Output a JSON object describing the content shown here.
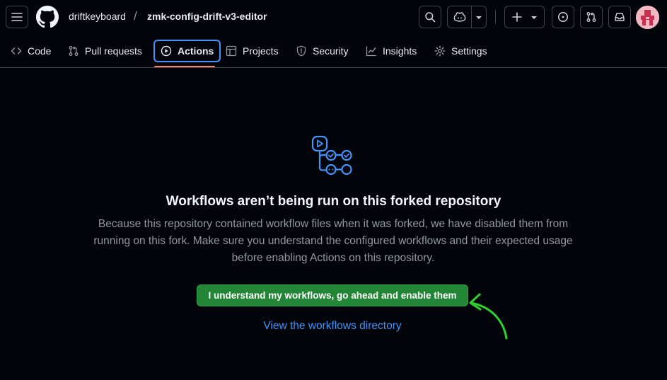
{
  "header": {
    "owner": "driftkeyboard",
    "separator": "/",
    "repo": "zmk-config-drift-v3-editor",
    "icons": [
      "menu-icon",
      "github-logo",
      "search-icon",
      "copilot-icon",
      "chevron-down-icon",
      "plus-icon",
      "issues-icon",
      "pull-requests-icon",
      "inbox-icon",
      "avatar"
    ]
  },
  "tabs": [
    {
      "label": "Code",
      "icon": "code-icon"
    },
    {
      "label": "Pull requests",
      "icon": "git-pull-request-icon"
    },
    {
      "label": "Actions",
      "icon": "play-icon",
      "selected": true
    },
    {
      "label": "Projects",
      "icon": "table-icon"
    },
    {
      "label": "Security",
      "icon": "shield-icon"
    },
    {
      "label": "Insights",
      "icon": "graph-icon"
    },
    {
      "label": "Settings",
      "icon": "gear-icon"
    }
  ],
  "blank": {
    "icon": "workflow-icon",
    "title": "Workflows aren’t being run on this forked repository",
    "description": "Because this repository contained workflow files when it was forked, we have disabled them from running on this fork. Make sure you understand the configured workflows and their expected usage before enabling Actions on this repository.",
    "enable_label": "I understand my workflows, go ahead and enable them",
    "view_link": "View the workflows directory"
  },
  "colors": {
    "background": "#010409",
    "accent_blue": "#4493f8",
    "primary_green": "#238636",
    "annotation_green": "#2ed12e",
    "tab_underline": "#f78166"
  }
}
